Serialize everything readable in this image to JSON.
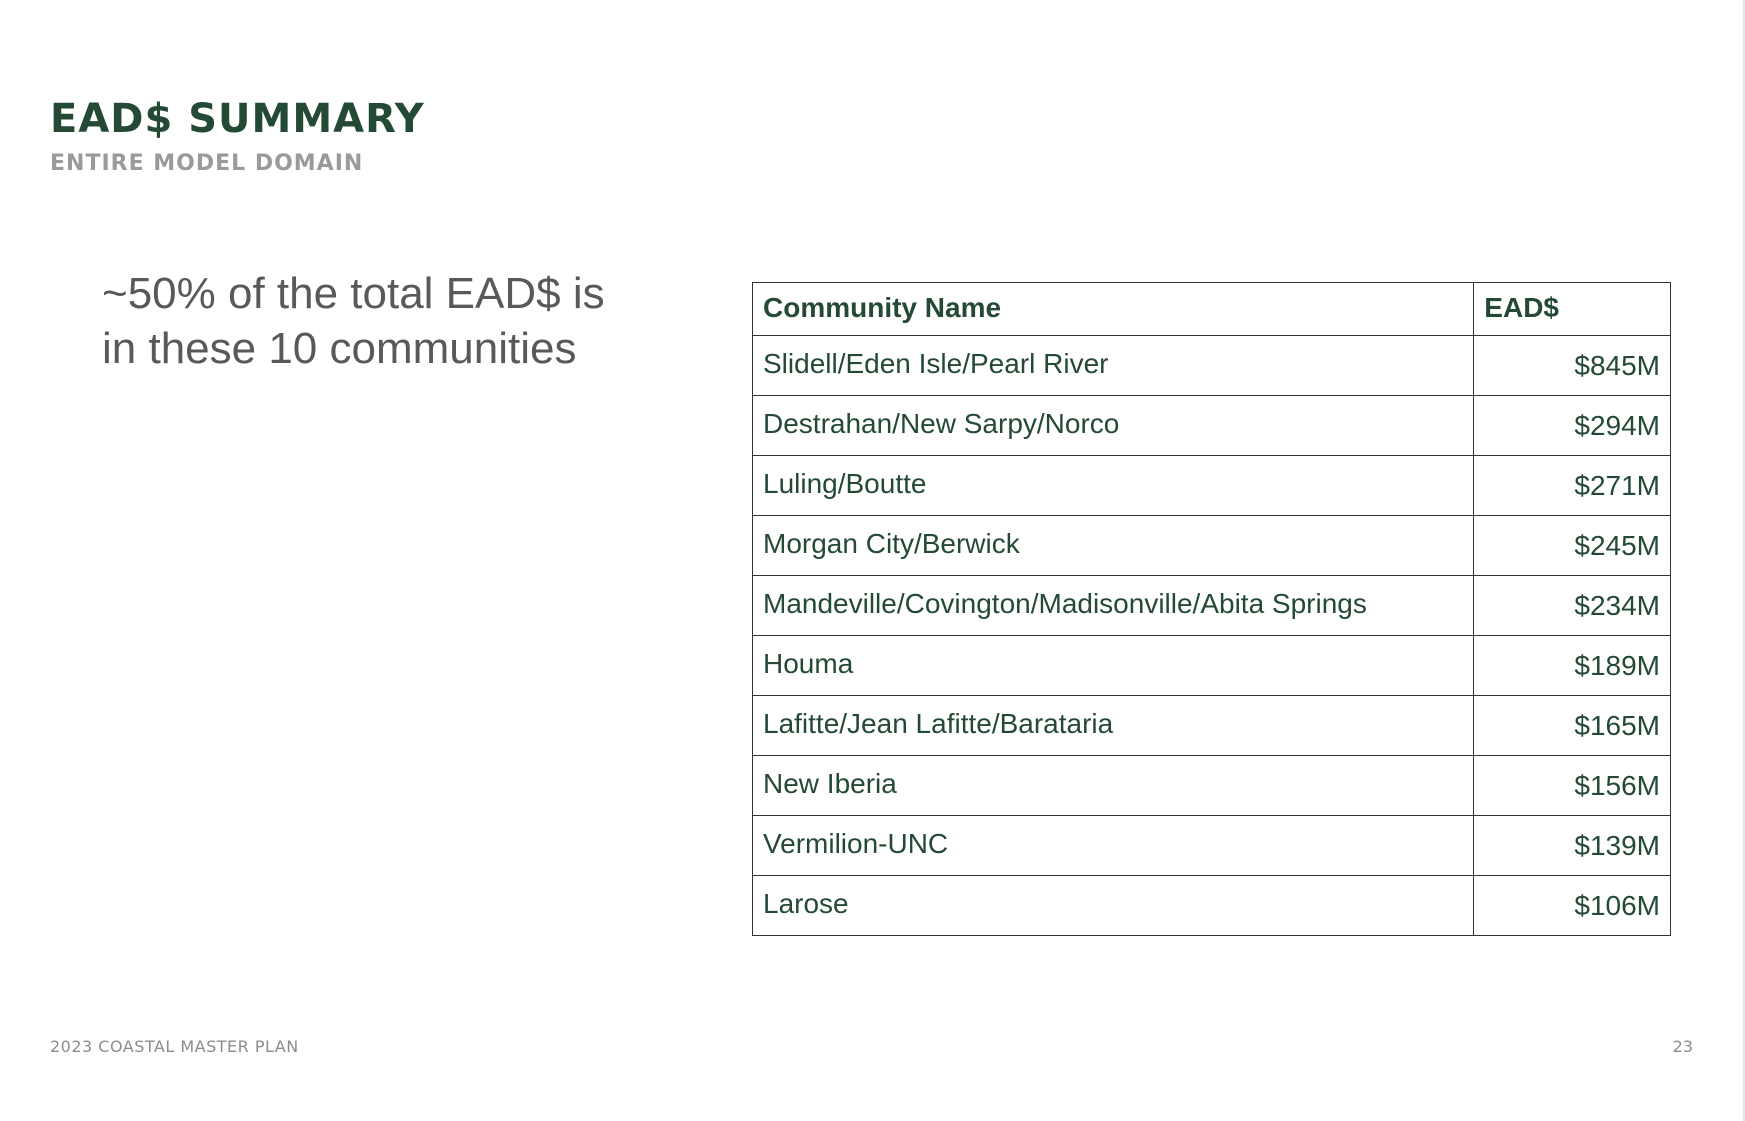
{
  "slide": {
    "title": "EAD$ SUMMARY",
    "subtitle": "ENTIRE MODEL DOMAIN",
    "callout_line1": "~50% of the total EAD$ is",
    "callout_line2": "in these 10 communities"
  },
  "table": {
    "headers": [
      "Community Name",
      "EAD$"
    ],
    "rows": [
      {
        "community": "Slidell/Eden Isle/Pearl River",
        "ead": "$845M"
      },
      {
        "community": "Destrahan/New Sarpy/Norco",
        "ead": "$294M"
      },
      {
        "community": "Luling/Boutte",
        "ead": "$271M"
      },
      {
        "community": "Morgan City/Berwick",
        "ead": "$245M"
      },
      {
        "community": "Mandeville/Covington/Madisonville/Abita Springs",
        "ead": "$234M"
      },
      {
        "community": "Houma",
        "ead": "$189M"
      },
      {
        "community": "Lafitte/Jean Lafitte/Barataria",
        "ead": "$165M"
      },
      {
        "community": "New Iberia",
        "ead": "$156M"
      },
      {
        "community": "Vermilion-UNC",
        "ead": "$139M"
      },
      {
        "community": "Larose",
        "ead": "$106M"
      }
    ]
  },
  "footer": {
    "left": "2023 COASTAL MASTER PLAN",
    "page_number": "23"
  },
  "colors": {
    "title": "#244a36",
    "subtitle": "#9a9a9a",
    "body_text": "#595959",
    "table_text": "#244a36"
  }
}
